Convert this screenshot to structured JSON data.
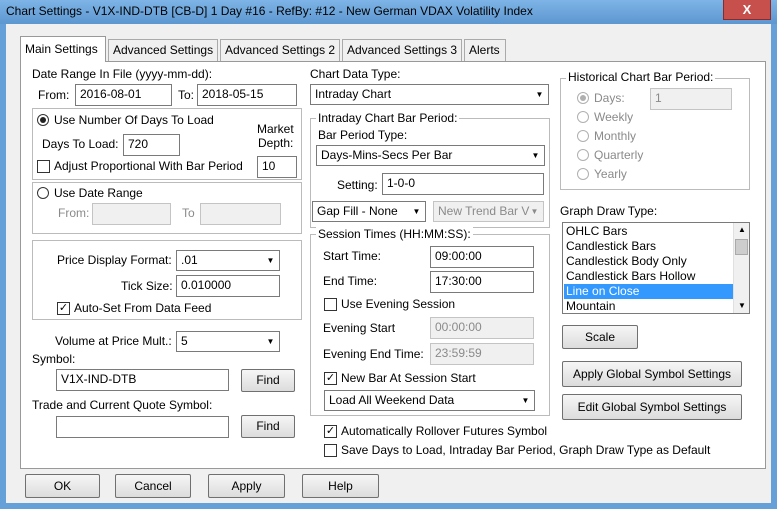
{
  "window": {
    "title": "Chart Settings - V1X-IND-DTB [CB-D]  1 Day   #16 - RefBy: #12 - New German VDAX Volatility Index",
    "close_label": "X"
  },
  "tabs": [
    {
      "label": "Main Settings",
      "active": true
    },
    {
      "label": "Advanced Settings",
      "active": false
    },
    {
      "label": "Advanced Settings 2",
      "active": false
    },
    {
      "label": "Advanced Settings 3",
      "active": false
    },
    {
      "label": "Alerts",
      "active": false
    }
  ],
  "date_range": {
    "label": "Date Range In File (yyyy-mm-dd):",
    "from_label": "From:",
    "from_value": "2016-08-01",
    "to_label": "To:",
    "to_value": "2018-05-15"
  },
  "days_to_load": {
    "radio_label": "Use Number Of Days To Load",
    "days_label": "Days To Load:",
    "days_value": "720",
    "market_depth_label_1": "Market",
    "market_depth_label_2": "Depth:",
    "market_depth_value": "10",
    "adjust_label": "Adjust Proportional With Bar Period"
  },
  "date_range_mode": {
    "radio_label": "Use Date Range",
    "from_label": "From:",
    "to_label": "To"
  },
  "price": {
    "format_label": "Price Display Format:",
    "format_value": ".01",
    "tick_label": "Tick Size:",
    "tick_value": "0.010000",
    "autoset_label": "Auto-Set From Data Feed",
    "volume_label": "Volume at Price Mult.:",
    "volume_value": "5"
  },
  "symbol": {
    "label": "Symbol:",
    "value": "V1X-IND-DTB",
    "find_label": "Find",
    "trade_label": "Trade and Current Quote Symbol:",
    "trade_value": "",
    "find2_label": "Find"
  },
  "chart_data_type": {
    "label": "Chart Data Type:",
    "value": "Intraday Chart"
  },
  "intraday_bar_period": {
    "label": "Intraday Chart Bar Period:",
    "type_label": "Bar Period Type:",
    "type_value": "Days-Mins-Secs Per Bar",
    "setting_label": "Setting:",
    "setting_value": "1-0-0",
    "gapfill_value": "Gap Fill - None",
    "newtrend_value": "New Trend Bar V"
  },
  "session_times": {
    "label": "Session Times (HH:MM:SS):",
    "start_label": "Start Time:",
    "start_value": "09:00:00",
    "end_label": "End Time:",
    "end_value": "17:30:00",
    "evening_label": "Use Evening Session",
    "evening_start_label": "Evening Start",
    "evening_start_value": "00:00:00",
    "evening_end_label": "Evening End Time:",
    "evening_end_value": "23:59:59",
    "newbar_label": "New Bar At Session Start",
    "weekend_value": "Load All Weekend Data"
  },
  "rollover_label": "Automatically Rollover Futures Symbol",
  "save_default_label": "Save Days to Load, Intraday Bar Period, Graph Draw Type as Default",
  "historical": {
    "label": "Historical Chart Bar Period:",
    "options": [
      "Days:",
      "Weekly",
      "Monthly",
      "Quarterly",
      "Yearly"
    ],
    "days_value": "1"
  },
  "graph_draw": {
    "label": "Graph Draw Type:",
    "items": [
      "OHLC Bars",
      "Candlestick Bars",
      "Candlestick Body Only",
      "Candlestick Bars Hollow",
      "Line on Close",
      "Mountain"
    ],
    "selected": "Line on Close"
  },
  "buttons": {
    "scale": "Scale",
    "apply_global": "Apply Global Symbol Settings",
    "edit_global": "Edit Global Symbol Settings",
    "ok": "OK",
    "cancel": "Cancel",
    "apply": "Apply",
    "help": "Help"
  },
  "colors": {
    "titlebar": "#66a0d8",
    "selection": "#3399ff",
    "close_button": "#c7504c"
  }
}
